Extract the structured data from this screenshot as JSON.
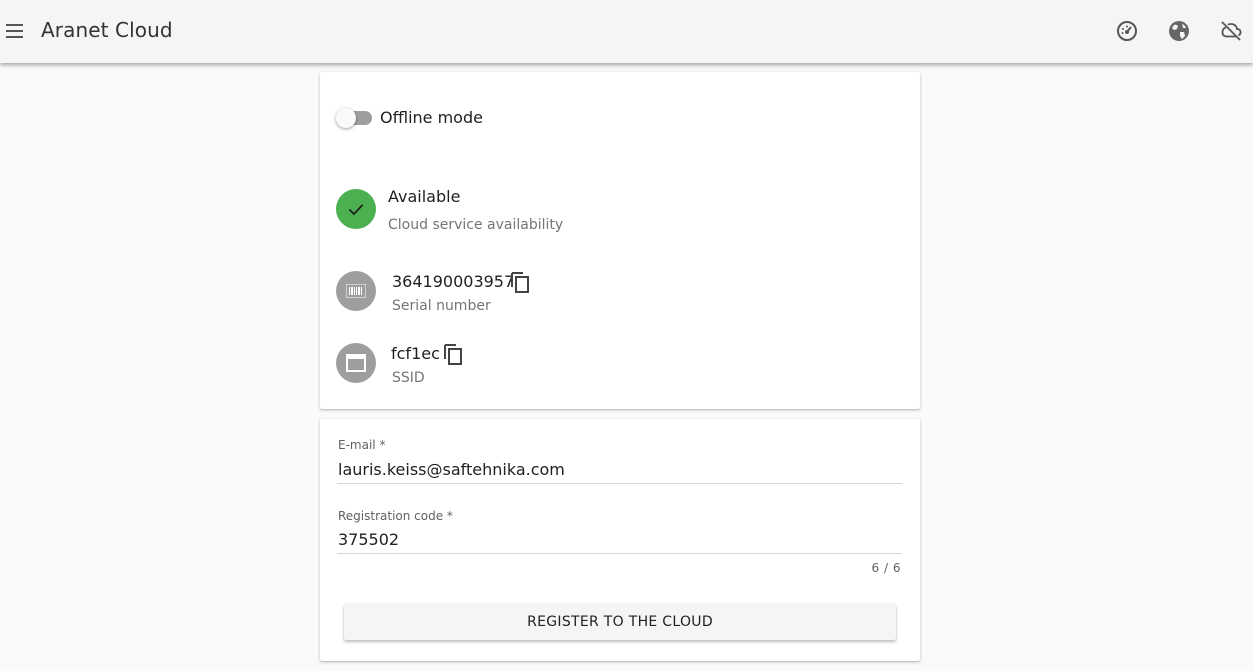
{
  "header": {
    "menu_icon": "hamburger-menu-icon",
    "title": "Aranet Cloud",
    "icons": [
      "dashboard-gauge-icon",
      "globe-icon",
      "cloud-off-icon"
    ]
  },
  "status_card": {
    "offline_toggle": {
      "label": "Offline mode",
      "enabled": false
    },
    "availability": {
      "value": "Available",
      "caption": "Cloud service availability",
      "icon": "check-icon",
      "color": "#4caf50"
    },
    "serial": {
      "value": "364190003957",
      "caption": "Serial number",
      "icon": "barcode-icon"
    },
    "ssid": {
      "value": "fcf1ec",
      "caption": "SSID",
      "icon": "window-icon"
    }
  },
  "registration_card": {
    "email": {
      "label": "E-mail *",
      "value": "lauris.keiss@saftehnika.com"
    },
    "code": {
      "label": "Registration code *",
      "value": "375502",
      "counter": "6 / 6"
    },
    "submit_label": "REGISTER TO THE CLOUD"
  }
}
